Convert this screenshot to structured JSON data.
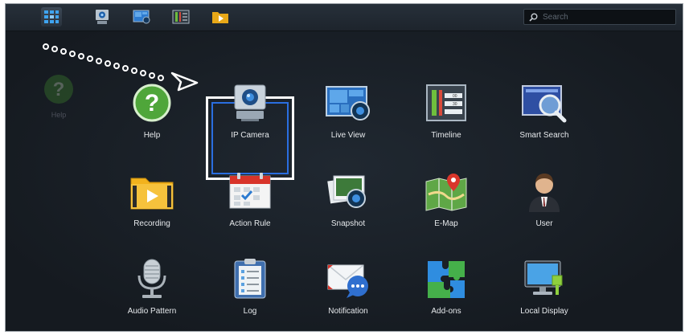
{
  "taskbar": {
    "buttons": [
      {
        "icon": "main-menu-icon",
        "active": true
      },
      {
        "icon": "ip-camera-icon",
        "active": false
      },
      {
        "icon": "live-view-icon",
        "active": false
      },
      {
        "icon": "timeline-icon",
        "active": false
      },
      {
        "icon": "recording-icon",
        "active": false
      }
    ],
    "search_placeholder": "Search"
  },
  "desktop_shortcut": {
    "label": "Help",
    "icon": "help-icon"
  },
  "apps": [
    {
      "label": "Help",
      "icon": "help-icon"
    },
    {
      "label": "IP Camera",
      "icon": "ip-camera-icon",
      "highlighted": true
    },
    {
      "label": "Live View",
      "icon": "live-view-icon"
    },
    {
      "label": "Timeline",
      "icon": "timeline-icon"
    },
    {
      "label": "Smart Search",
      "icon": "smart-search-icon"
    },
    {
      "label": "Recording",
      "icon": "recording-folder-icon"
    },
    {
      "label": "Action Rule",
      "icon": "action-rule-calendar-icon"
    },
    {
      "label": "Snapshot",
      "icon": "snapshot-icon"
    },
    {
      "label": "E-Map",
      "icon": "e-map-icon"
    },
    {
      "label": "User",
      "icon": "user-icon"
    },
    {
      "label": "Audio Pattern",
      "icon": "microphone-icon"
    },
    {
      "label": "Log",
      "icon": "log-clipboard-icon"
    },
    {
      "label": "Notification",
      "icon": "notification-envelope-icon"
    },
    {
      "label": "Add-ons",
      "icon": "add-ons-puzzle-icon"
    },
    {
      "label": "Local Display",
      "icon": "local-display-monitor-icon"
    }
  ],
  "colors": {
    "background": "#1b2128",
    "highlight_outer": "#ffffff",
    "highlight_inner": "#2a6ee0"
  }
}
